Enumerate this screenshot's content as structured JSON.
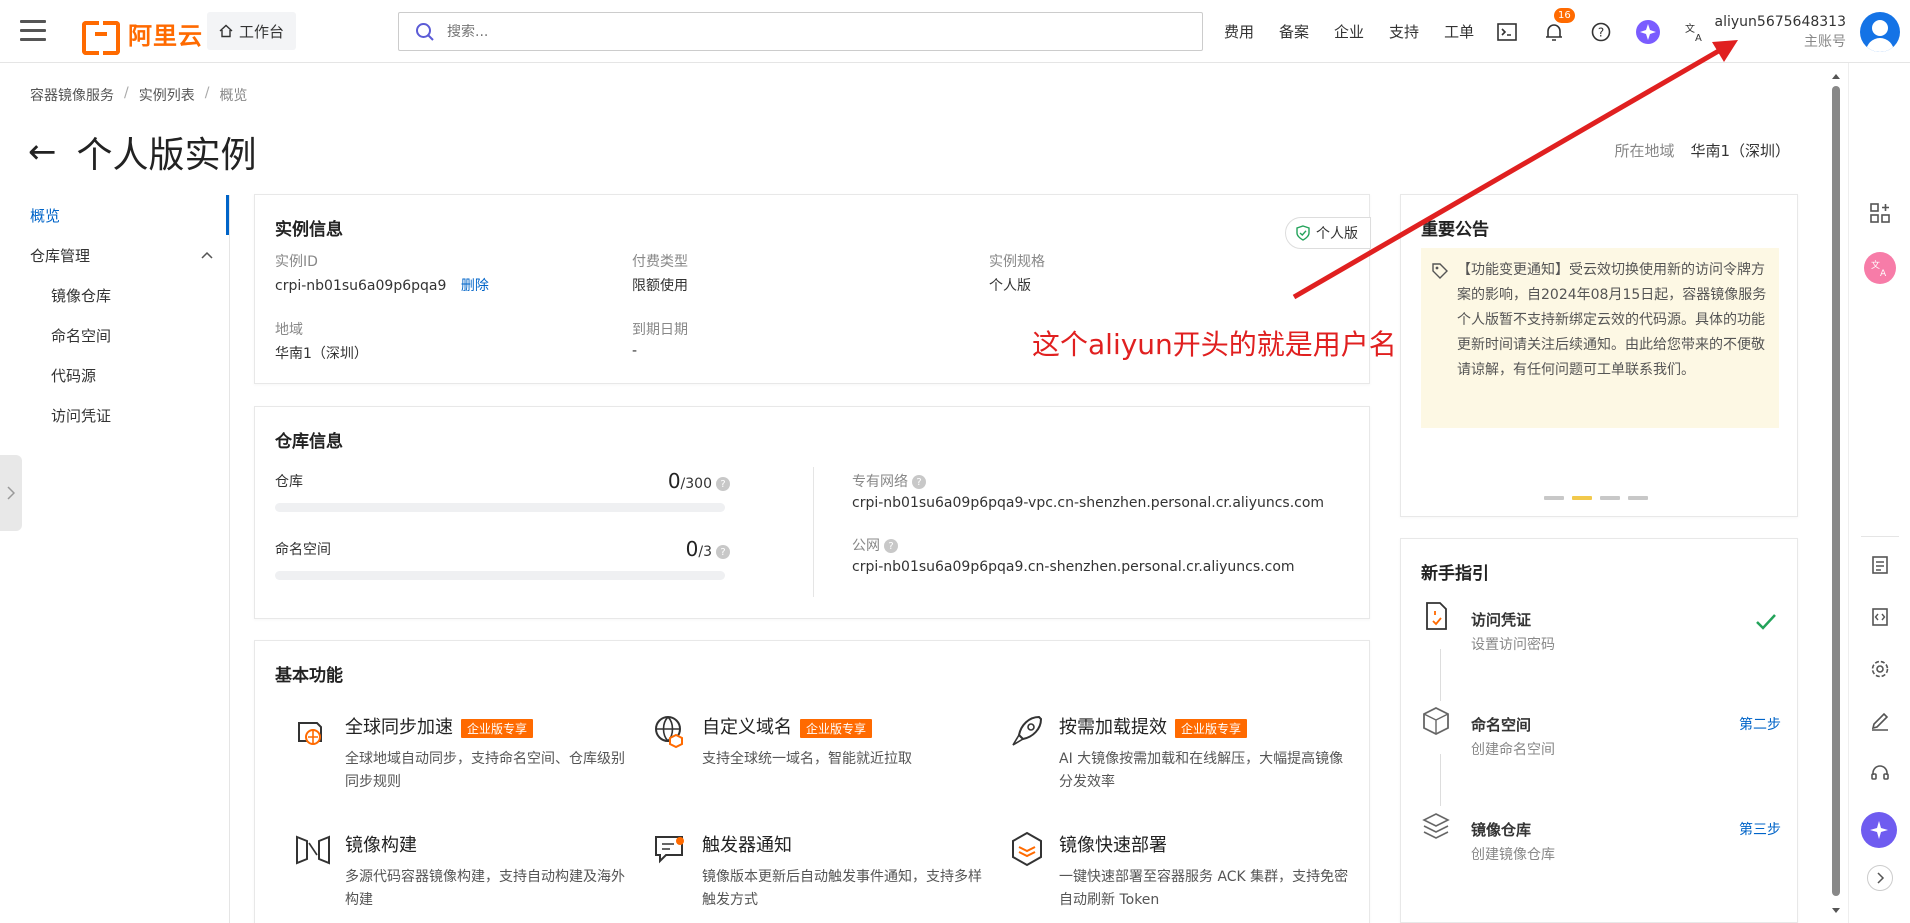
{
  "topbar": {
    "logo_text": "阿里云",
    "workbench_label": "工作台",
    "search_placeholder": "搜索...",
    "links": [
      "费用",
      "备案",
      "企业",
      "支持",
      "工单"
    ],
    "notification_count": "16",
    "username": "aliyun5675648313",
    "account_type": "主账号"
  },
  "breadcrumb": [
    "容器镜像服务",
    "实例列表",
    "概览"
  ],
  "page_title": "个人版实例",
  "region": {
    "label": "所在地域",
    "value": "华南1（深圳）"
  },
  "leftnav": {
    "overview": "概览",
    "repo_management": "仓库管理",
    "sub_items": [
      "镜像仓库",
      "命名空间",
      "代码源",
      "访问凭证"
    ]
  },
  "instance_info": {
    "title": "实例信息",
    "badge": "个人版",
    "id_label": "实例ID",
    "id_value": "crpi-nb01su6a09p6pqa9",
    "delete_label": "删除",
    "pay_label": "付费类型",
    "pay_value": "限额使用",
    "spec_label": "实例规格",
    "spec_value": "个人版",
    "region_label": "地域",
    "region_value": "华南1（深圳）",
    "expire_label": "到期日期",
    "expire_value": "-"
  },
  "repo_info": {
    "title": "仓库信息",
    "repo_label": "仓库",
    "repo_count": "0",
    "repo_limit": "/300",
    "ns_label": "命名空间",
    "ns_count": "0",
    "ns_limit": "/3",
    "vpc_label": "专有网络",
    "vpc_value": "crpi-nb01su6a09p6pqa9-vpc.cn-shenzhen.personal.cr.aliyuncs.com",
    "public_label": "公网",
    "public_value": "crpi-nb01su6a09p6pqa9.cn-shenzhen.personal.cr.aliyuncs.com"
  },
  "basic_features": {
    "title": "基本功能",
    "enterprise_tag": "企业版专享",
    "items": [
      {
        "name": "全球同步加速",
        "desc": "全球地域自动同步，支持命名空间、仓库级别同步规则",
        "icon": "global-sync-icon"
      },
      {
        "name": "自定义域名",
        "desc": "支持全球统一域名，智能就近拉取",
        "icon": "custom-domain-icon"
      },
      {
        "name": "按需加载提效",
        "desc": "AI 大镜像按需加载和在线解压，大幅提高镜像分发效率",
        "icon": "rocket-icon"
      },
      {
        "name": "镜像构建",
        "desc": "多源代码容器镜像构建，支持自动构建及海外构建",
        "icon": "image-build-icon"
      },
      {
        "name": "触发器通知",
        "desc": "镜像版本更新后自动触发事件通知，支持多样触发方式",
        "icon": "trigger-icon"
      },
      {
        "name": "镜像快速部署",
        "desc": "一键快速部署至容器服务 ACK 集群，支持免密自动刷新 Token",
        "icon": "deploy-icon"
      }
    ]
  },
  "announcement": {
    "title": "重要公告",
    "text": "【功能变更通知】受云效切换使用新的访问令牌方案的影响，自2024年08月15日起，容器镜像服务个人版暂不支持新绑定云效的代码源。具体的功能更新时间请关注后续通知。由此给您带来的不便敬请谅解，有任何问题可工单联系我们。"
  },
  "guide": {
    "title": "新手指引",
    "steps": [
      {
        "name": "访问凭证",
        "desc": "设置访问密码",
        "right": ""
      },
      {
        "name": "命名空间",
        "desc": "创建命名空间",
        "right": "第二步"
      },
      {
        "name": "镜像仓库",
        "desc": "创建镜像仓库",
        "right": "第三步"
      }
    ]
  },
  "annotation": "这个aliyun开头的就是用户名",
  "colors": {
    "accent": "#0064c8",
    "brand": "#ff6a00",
    "annotation": "#e02020"
  }
}
